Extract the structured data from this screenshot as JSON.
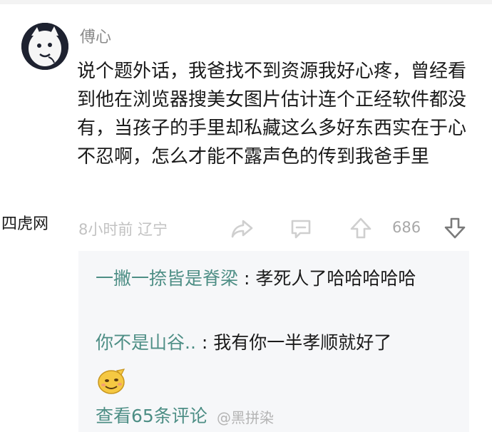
{
  "post": {
    "username": "傅心",
    "text": "说个题外话，我爸找不到资源我好心疼，曾经看到他在浏览器搜美女图片估计连个正经软件都没有，当孩子的手里却私藏这么多好东西实在于心不忍啊，怎么才能不露声色的传到我爸手里",
    "meta_time": "8小时前 辽宁",
    "vote_count": "686"
  },
  "watermark_left": "四虎网",
  "replies": [
    {
      "author": "一撇一捺皆是脊梁",
      "separator": " : ",
      "text": "孝死人了哈哈哈哈哈"
    },
    {
      "author": "你不是山谷..",
      "separator": " : ",
      "text": "我有你一半孝顺就好了"
    }
  ],
  "view_more": "查看65条评论",
  "weibo_watermark": "@黑拼染",
  "icons": [
    "avatar",
    "share-icon",
    "comment-icon",
    "upvote-icon",
    "downvote-icon",
    "emoji-icon"
  ]
}
